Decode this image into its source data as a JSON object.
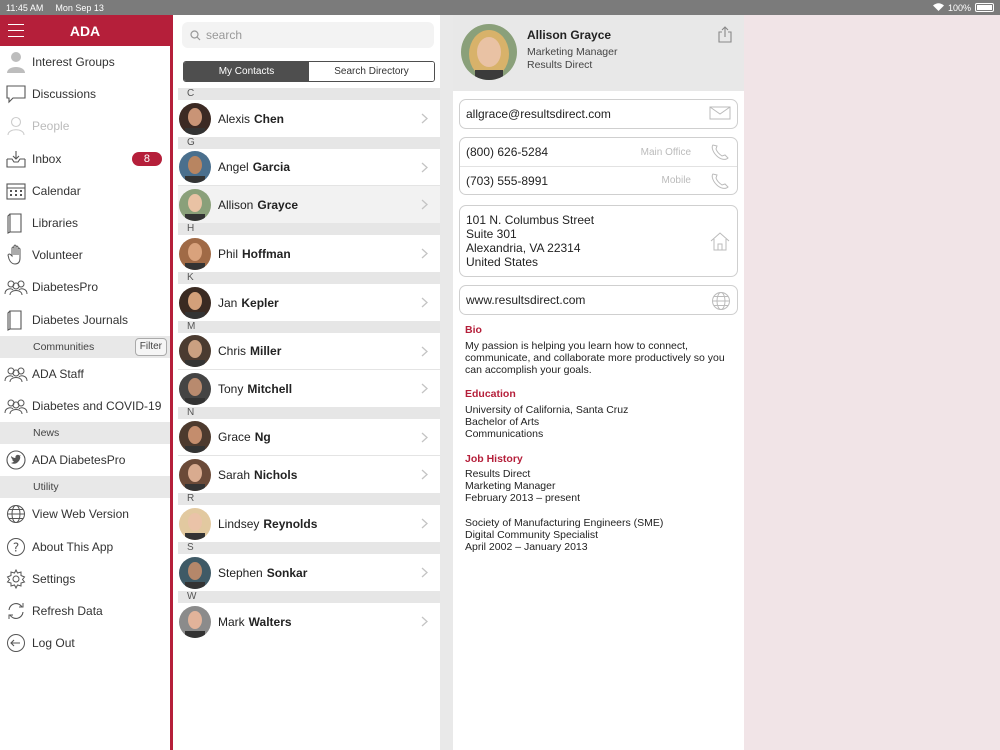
{
  "status": {
    "time": "11:45 AM",
    "date": "Mon Sep 13",
    "battery": "100%"
  },
  "sidebar": {
    "title": "ADA",
    "items": [
      {
        "label": "Interest Groups",
        "icon": "user-icon"
      },
      {
        "label": "Discussions",
        "icon": "chat-bubble-icon"
      },
      {
        "label": "People",
        "icon": "person-icon",
        "disabled": true
      },
      {
        "label": "Inbox",
        "icon": "inbox-icon",
        "badge": "8"
      },
      {
        "label": "Calendar",
        "icon": "calendar-icon"
      },
      {
        "label": "Libraries",
        "icon": "book-icon"
      },
      {
        "label": "Volunteer",
        "icon": "hand-icon"
      },
      {
        "label": "DiabetesPro",
        "icon": "group-icon"
      },
      {
        "label": "Diabetes Journals",
        "icon": "book-icon"
      }
    ],
    "sections": {
      "communities": {
        "label": "Communities",
        "filter": "Filter"
      },
      "news": {
        "label": "News"
      },
      "utility": {
        "label": "Utility"
      }
    },
    "community_items": [
      {
        "label": "ADA Staff",
        "icon": "group-icon"
      },
      {
        "label": "Diabetes and COVID-19",
        "icon": "group-icon"
      }
    ],
    "news_items": [
      {
        "label": "ADA DiabetesPro",
        "icon": "twitter-icon"
      }
    ],
    "utility_items": [
      {
        "label": "View Web Version",
        "icon": "globe-icon"
      },
      {
        "label": "About This App",
        "icon": "question-icon"
      },
      {
        "label": "Settings",
        "icon": "gear-icon"
      },
      {
        "label": "Refresh Data",
        "icon": "refresh-icon"
      },
      {
        "label": "Log Out",
        "icon": "logout-icon"
      }
    ]
  },
  "contacts": {
    "search_placeholder": "search",
    "tabs": [
      "My Contacts",
      "Search Directory"
    ],
    "groups": [
      {
        "letter": "C",
        "people": [
          {
            "first": "Alexis",
            "last": "Chen"
          }
        ]
      },
      {
        "letter": "G",
        "people": [
          {
            "first": "Angel",
            "last": "Garcia"
          },
          {
            "first": "Allison",
            "last": "Grayce"
          }
        ]
      },
      {
        "letter": "H",
        "people": [
          {
            "first": "Phil",
            "last": "Hoffman"
          }
        ]
      },
      {
        "letter": "K",
        "people": [
          {
            "first": "Jan",
            "last": "Kepler"
          }
        ]
      },
      {
        "letter": "M",
        "people": [
          {
            "first": "Chris",
            "last": "Miller"
          },
          {
            "first": "Tony",
            "last": "Mitchell"
          }
        ]
      },
      {
        "letter": "N",
        "people": [
          {
            "first": "Grace",
            "last": "Ng"
          },
          {
            "first": "Sarah",
            "last": "Nichols"
          }
        ]
      },
      {
        "letter": "R",
        "people": [
          {
            "first": "Lindsey",
            "last": "Reynolds"
          }
        ]
      },
      {
        "letter": "S",
        "people": [
          {
            "first": "Stephen",
            "last": "Sonkar"
          }
        ]
      },
      {
        "letter": "W",
        "people": [
          {
            "first": "Mark",
            "last": "Walters"
          }
        ]
      }
    ]
  },
  "detail": {
    "name": "Allison Grayce",
    "title": "Marketing Manager",
    "company": "Results Direct",
    "email": "allgrace@resultsdirect.com",
    "phones": [
      {
        "number": "(800) 626-5284",
        "label": "Main Office"
      },
      {
        "number": "(703) 555-8991",
        "label": "Mobile"
      }
    ],
    "address": [
      "101 N. Columbus Street",
      "Suite 301",
      "Alexandria, VA 22314",
      "United States"
    ],
    "website": "www.resultsdirect.com",
    "bio_title": "Bio",
    "bio": "My passion is helping you learn how to connect, communicate, and collaborate more productively so you can accomplish your goals.",
    "education_title": "Education",
    "education": [
      "University of California, Santa Cruz",
      "Bachelor of Arts",
      "Communications"
    ],
    "job_title": "Job History",
    "jobs": [
      [
        "Results Direct",
        "Marketing Manager",
        "February 2013 – present"
      ],
      [
        "Society of Manufacturing Engineers (SME)",
        "Digital Community Specialist",
        "April 2002 – January 2013"
      ]
    ]
  },
  "colors": {
    "brand": "#b51f3a",
    "segment": "#4e4e4e",
    "background": "#f1e4e7"
  }
}
